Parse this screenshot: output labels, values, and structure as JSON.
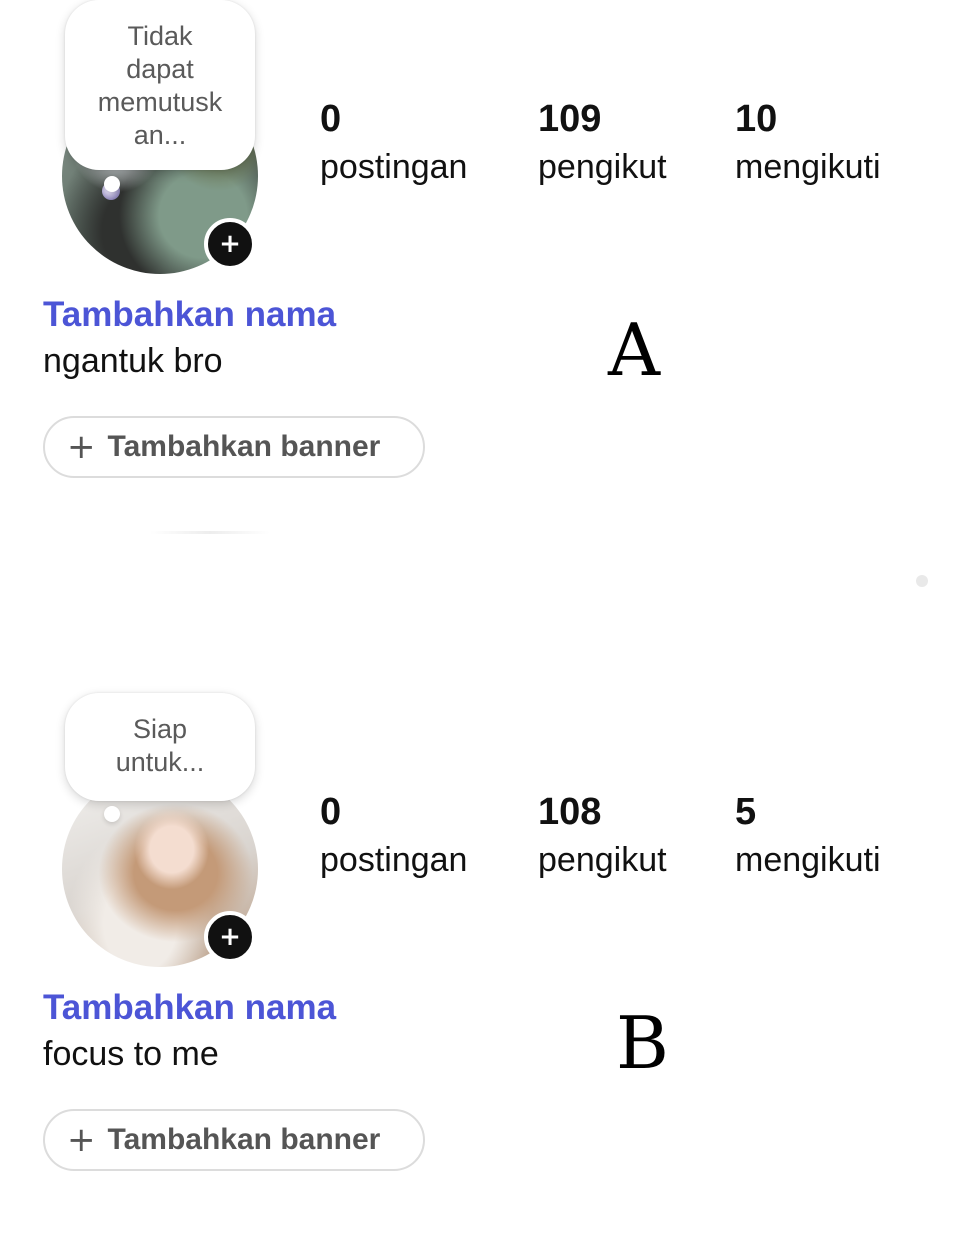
{
  "profiles": [
    {
      "marker": "A",
      "note": "Tidak\ndapat\nmemutusk\nan...",
      "stats": [
        {
          "count": "0",
          "label": "postingan"
        },
        {
          "count": "109",
          "label": "pengikut"
        },
        {
          "count": "10",
          "label": "mengikuti"
        }
      ],
      "name_link": "Tambahkan nama",
      "bio": "ngantuk bro",
      "banner_button": "Tambahkan banner"
    },
    {
      "marker": "B",
      "note": "Siap\nuntuk...",
      "stats": [
        {
          "count": "0",
          "label": "postingan"
        },
        {
          "count": "108",
          "label": "pengikut"
        },
        {
          "count": "5",
          "label": "mengikuti"
        }
      ],
      "name_link": "Tambahkan nama",
      "bio": "focus to me",
      "banner_button": "Tambahkan banner"
    }
  ],
  "icons": {
    "add_badge": "plus-icon",
    "banner_plus": "plus-icon"
  },
  "colors": {
    "name_link": "#4c55d6",
    "badge": "#111111"
  }
}
